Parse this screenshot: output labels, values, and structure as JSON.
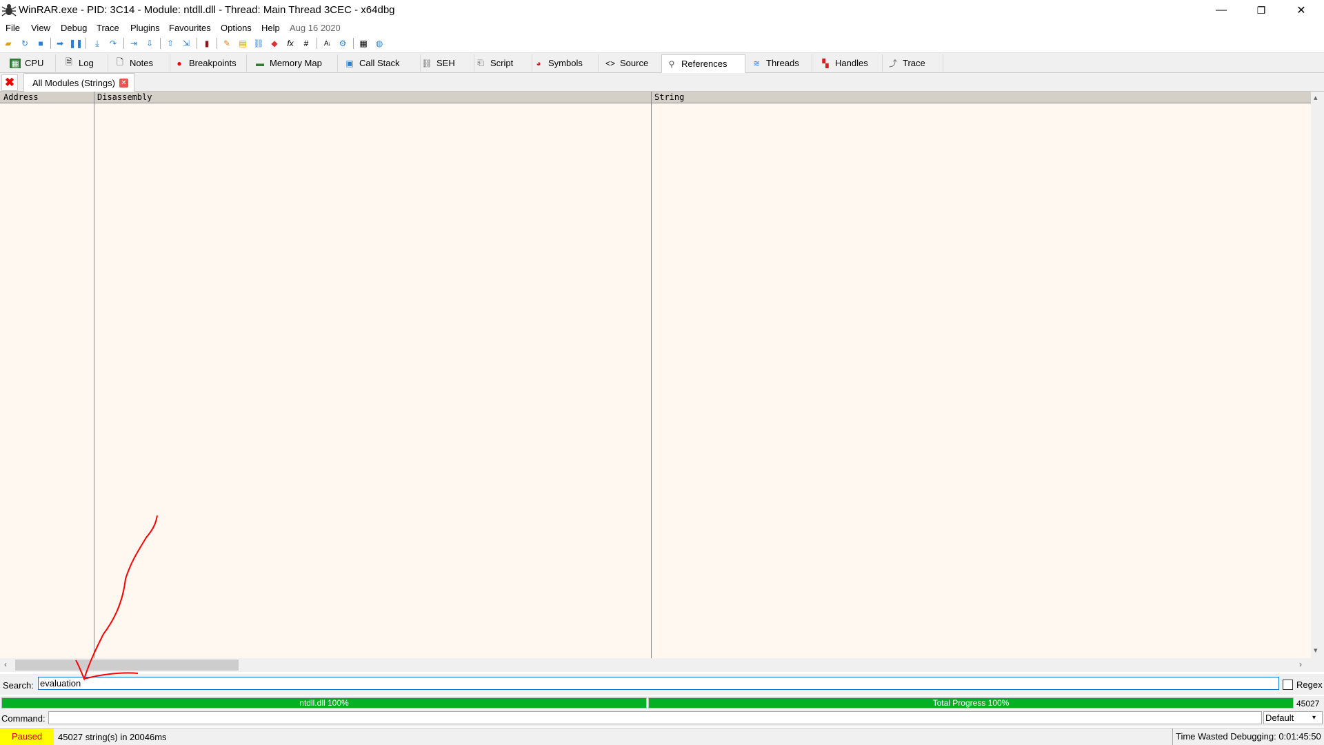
{
  "window": {
    "title": "WinRAR.exe - PID: 3C14 - Module: ntdll.dll - Thread: Main Thread 3CEC - x64dbg",
    "minimize": "—",
    "restore": "❐",
    "close": "✕"
  },
  "menu": {
    "items": [
      "File",
      "View",
      "Debug",
      "Trace",
      "Plugins",
      "Favourites",
      "Options",
      "Help"
    ],
    "build_date": "Aug 16 2020"
  },
  "tabs": [
    {
      "label": "CPU",
      "icon": "cpu-icon"
    },
    {
      "label": "Log",
      "icon": "log-icon"
    },
    {
      "label": "Notes",
      "icon": "notes-icon"
    },
    {
      "label": "Breakpoints",
      "icon": "breakpoint-icon"
    },
    {
      "label": "Memory Map",
      "icon": "memory-map-icon"
    },
    {
      "label": "Call Stack",
      "icon": "call-stack-icon"
    },
    {
      "label": "SEH",
      "icon": "seh-icon"
    },
    {
      "label": "Script",
      "icon": "script-icon"
    },
    {
      "label": "Symbols",
      "icon": "symbols-icon"
    },
    {
      "label": "Source",
      "icon": "source-icon"
    },
    {
      "label": "References",
      "icon": "references-icon"
    },
    {
      "label": "Threads",
      "icon": "threads-icon"
    },
    {
      "label": "Handles",
      "icon": "handles-icon"
    },
    {
      "label": "Trace",
      "icon": "trace-icon"
    }
  ],
  "active_tab": "References",
  "subtab": {
    "label": "All Modules (Strings)"
  },
  "table": {
    "columns": [
      "Address",
      "Disassembly",
      "String"
    ],
    "rows": []
  },
  "search": {
    "label": "Search:",
    "value": "evaluation",
    "regex_label": "Regex",
    "regex_checked": false
  },
  "progress": {
    "module_label": "ntdll.dll 100%",
    "module_percent": 100,
    "total_label": "Total Progress 100%",
    "total_percent": 100,
    "count": "45027"
  },
  "command": {
    "label": "Command:",
    "value": "",
    "mode": "Default"
  },
  "status": {
    "state": "Paused",
    "message": "45027 string(s) in 20046ms",
    "time_wasted": "Time Wasted Debugging: 0:01:45:50"
  },
  "colors": {
    "accent": "#0078d7",
    "progress": "#06b025",
    "paused_bg": "#ffff00",
    "annotation": "#ff0000"
  }
}
